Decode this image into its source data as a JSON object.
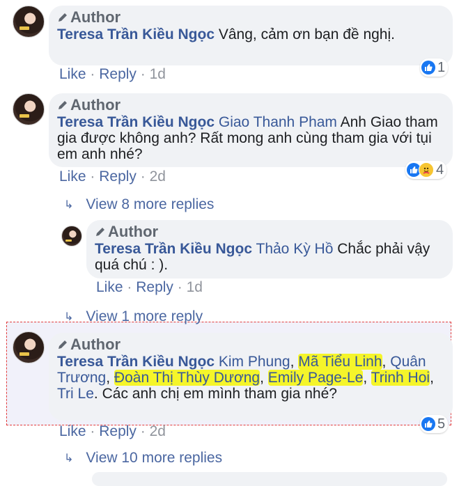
{
  "badge": "Author",
  "comments": [
    {
      "author": "Teresa Trần Kiều Ngọc",
      "text": "Vâng, cảm ơn bạn đề nghị.",
      "like": "Like",
      "reply": "Reply",
      "time": "1d",
      "reaction_count": "1"
    },
    {
      "author": "Teresa Trần Kiều Ngọc",
      "mention": "Giao Thanh Pham",
      "text": "Anh Giao tham gia được không anh? Rất mong anh cùng tham gia với tụi em anh nhé?",
      "like": "Like",
      "reply": "Reply",
      "time": "2d",
      "reaction_count": "4",
      "view_more": "View 8 more replies"
    },
    {
      "author": "Teresa Trần Kiều Ngọc",
      "mention": "Thảo Kỳ Hồ",
      "text": "Chắc phải vậy quá chú : ).",
      "like": "Like",
      "reply": "Reply",
      "time": "1d",
      "view_more": "View 1 more reply"
    },
    {
      "author": "Teresa Trần Kiều Ngọc",
      "mentions": [
        "Kim Phung",
        "Mã Tiểu Linh",
        "Quân Trương",
        "Đoàn Thị Thùy Dương",
        "Emily Page-Le",
        "Trinh Hoi",
        "Tri Le"
      ],
      "text": "Các anh chị em mình tham gia nhé?",
      "like": "Like",
      "reply": "Reply",
      "time": "2d",
      "reaction_count": "5",
      "view_more": "View 10 more replies"
    }
  ],
  "separator": "·",
  "comma": ",",
  "colors": {
    "bubble": "#f0f2f5",
    "link": "#385898",
    "highlight": "#f5f52a",
    "like_blue": "#1877f2",
    "selection_border": "#e23b3b"
  }
}
